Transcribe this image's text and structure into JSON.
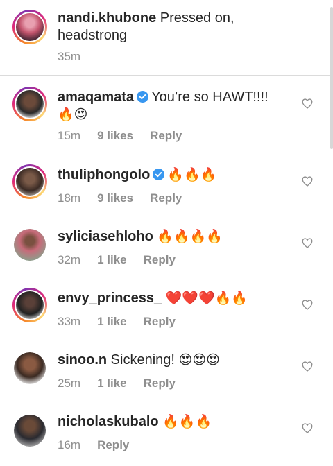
{
  "caption": {
    "username": "nandi.khubone",
    "text": "Pressed on,",
    "text_line2": "headstrong",
    "time": "35m"
  },
  "comments": [
    {
      "username": "amaqamata",
      "verified": true,
      "text": "You’re so HAWT!!!!",
      "emojis_line2": "🔥😍",
      "time": "15m",
      "likes": "9 likes",
      "reply": "Reply"
    },
    {
      "username": "thuliphongolo",
      "verified": true,
      "text": "",
      "emojis": "🔥🔥🔥",
      "time": "18m",
      "likes": "9 likes",
      "reply": "Reply"
    },
    {
      "username": "syliciasehloho",
      "verified": false,
      "text": "",
      "emojis": "🔥🔥🔥🔥",
      "time": "32m",
      "likes": "1 like",
      "reply": "Reply"
    },
    {
      "username": "envy_princess_",
      "verified": false,
      "text": "",
      "emojis": "❤️❤️❤️🔥🔥",
      "time": "33m",
      "likes": "1 like",
      "reply": "Reply"
    },
    {
      "username": "sinoo.n",
      "verified": false,
      "text": "Sickening!",
      "emojis": "😍😍😍",
      "time": "25m",
      "likes": "1 like",
      "reply": "Reply"
    },
    {
      "username": "nicholaskubalo",
      "verified": false,
      "text": "",
      "emojis": "🔥🔥🔥",
      "time": "16m",
      "likes": "",
      "reply": "Reply"
    }
  ],
  "colors": {
    "meta": "#8e8e8e",
    "verified": "#3897f0",
    "text": "#262626"
  }
}
